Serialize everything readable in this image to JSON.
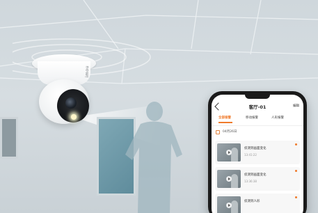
{
  "camera": {
    "brand": "imou"
  },
  "phone": {
    "title": "客厅-01",
    "edit_label": "编辑",
    "tabs": [
      {
        "label": "全部报警",
        "active": true
      },
      {
        "label": "移动报警",
        "active": false
      },
      {
        "label": "人形报警",
        "active": false
      }
    ],
    "date": "04月26日",
    "events": [
      {
        "title": "侦测到画面变化",
        "time": "13:41:22",
        "unread": true
      },
      {
        "title": "侦测到画面变化",
        "time": "13:36:38",
        "unread": true
      },
      {
        "title": "侦测到人形",
        "time": "",
        "unread": true
      }
    ]
  },
  "colors": {
    "accent": "#f07a2b",
    "window_glass": "#6f98a8"
  }
}
